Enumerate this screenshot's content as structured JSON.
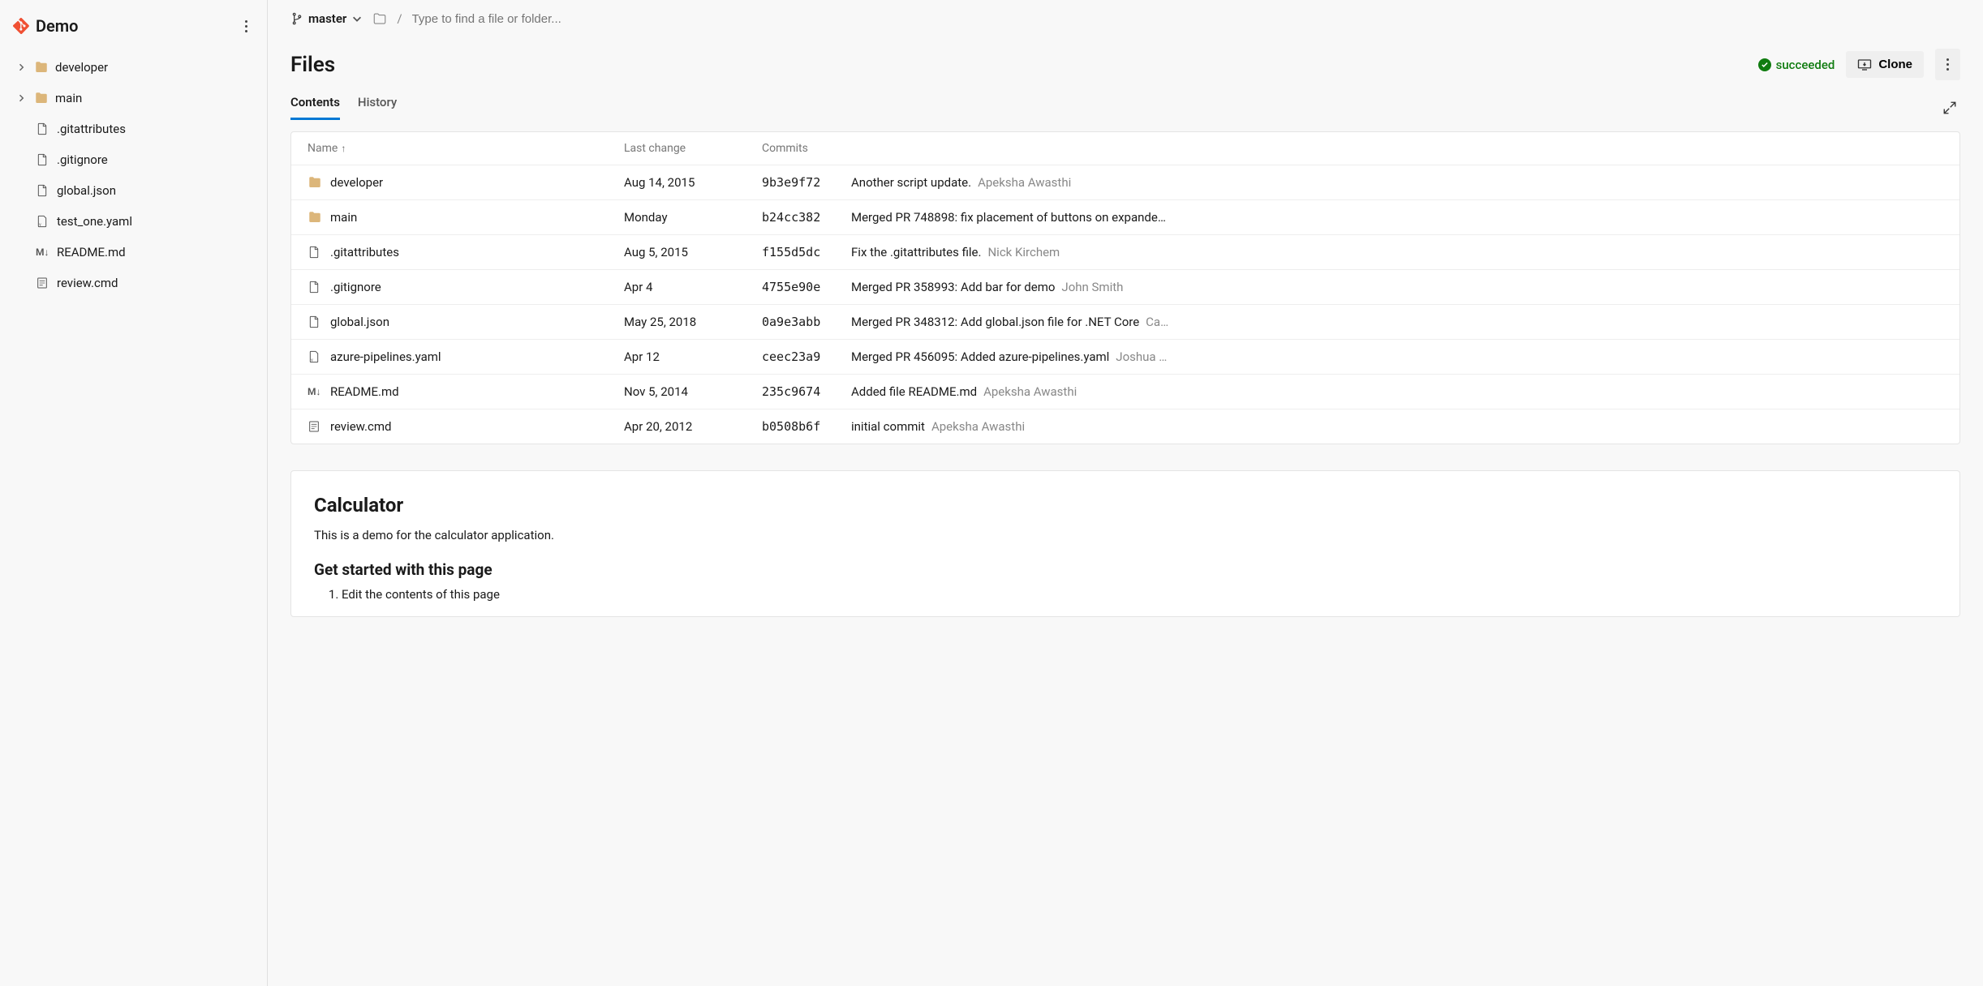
{
  "sidebar": {
    "repo_name": "Demo",
    "tree": [
      {
        "type": "folder",
        "name": "developer",
        "expandable": true
      },
      {
        "type": "folder",
        "name": "main",
        "expandable": true
      },
      {
        "type": "file",
        "name": ".gitattributes",
        "icon": "file"
      },
      {
        "type": "file",
        "name": ".gitignore",
        "icon": "file"
      },
      {
        "type": "file",
        "name": "global.json",
        "icon": "file"
      },
      {
        "type": "file",
        "name": "test_one.yaml",
        "icon": "yaml"
      },
      {
        "type": "file",
        "name": "README.md",
        "icon": "md"
      },
      {
        "type": "file",
        "name": "review.cmd",
        "icon": "cmd"
      }
    ]
  },
  "breadcrumb": {
    "branch": "master",
    "placeholder": "Type to find a file or folder..."
  },
  "header": {
    "title": "Files",
    "status": "succeeded",
    "clone_label": "Clone"
  },
  "tabs": {
    "contents": "Contents",
    "history": "History"
  },
  "table": {
    "columns": {
      "name": "Name",
      "last_change": "Last change",
      "commits": "Commits"
    },
    "rows": [
      {
        "icon": "folder",
        "name": "developer",
        "last_change": "Aug 14, 2015",
        "hash": "9b3e9f72",
        "msg": "Another script update.",
        "author": "Apeksha Awasthi"
      },
      {
        "icon": "folder",
        "name": "main",
        "last_change": "Monday",
        "hash": "b24cc382",
        "msg": "Merged PR 748898: fix placement of buttons on expande…",
        "author": ""
      },
      {
        "icon": "file",
        "name": ".gitattributes",
        "last_change": "Aug 5, 2015",
        "hash": "f155d5dc",
        "msg": "Fix the .gitattributes file.",
        "author": "Nick Kirchem"
      },
      {
        "icon": "file",
        "name": ".gitignore",
        "last_change": "Apr 4",
        "hash": "4755e90e",
        "msg": "Merged PR 358993: Add bar for demo",
        "author": "John Smith"
      },
      {
        "icon": "file",
        "name": "global.json",
        "last_change": "May 25, 2018",
        "hash": "0a9e3abb",
        "msg": "Merged PR 348312: Add global.json file for .NET Core",
        "author": "Ca…"
      },
      {
        "icon": "yaml",
        "name": "azure-pipelines.yaml",
        "last_change": "Apr 12",
        "hash": "ceec23a9",
        "msg": "Merged PR 456095: Added azure-pipelines.yaml",
        "author": "Joshua …"
      },
      {
        "icon": "md",
        "name": "README.md",
        "last_change": "Nov 5, 2014",
        "hash": "235c9674",
        "msg": "Added file README.md",
        "author": "Apeksha Awasthi"
      },
      {
        "icon": "cmd",
        "name": "review.cmd",
        "last_change": "Apr 20, 2012",
        "hash": "b0508b6f",
        "msg": "initial commit",
        "author": "Apeksha Awasthi"
      }
    ]
  },
  "readme": {
    "title": "Calculator",
    "intro": "This is a demo for the calculator application.",
    "subheading": "Get started with this page",
    "step1": "Edit the contents of this page"
  }
}
